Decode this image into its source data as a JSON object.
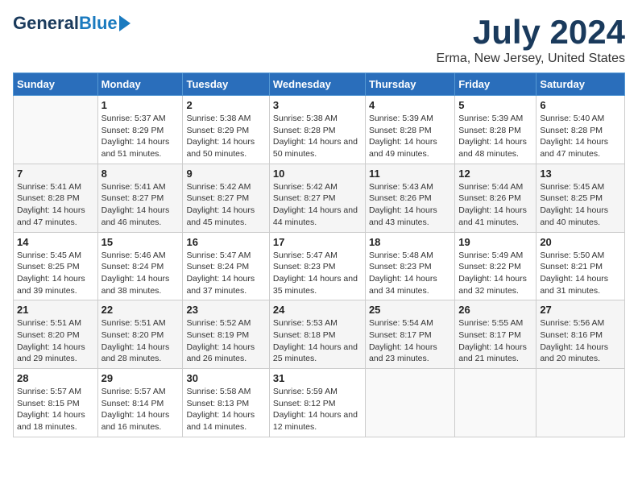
{
  "logo": {
    "general": "General",
    "blue": "Blue"
  },
  "title": "July 2024",
  "subtitle": "Erma, New Jersey, United States",
  "headers": [
    "Sunday",
    "Monday",
    "Tuesday",
    "Wednesday",
    "Thursday",
    "Friday",
    "Saturday"
  ],
  "rows": [
    [
      {
        "day": "",
        "sunrise": "",
        "sunset": "",
        "daylight": ""
      },
      {
        "day": "1",
        "sunrise": "Sunrise: 5:37 AM",
        "sunset": "Sunset: 8:29 PM",
        "daylight": "Daylight: 14 hours and 51 minutes."
      },
      {
        "day": "2",
        "sunrise": "Sunrise: 5:38 AM",
        "sunset": "Sunset: 8:29 PM",
        "daylight": "Daylight: 14 hours and 50 minutes."
      },
      {
        "day": "3",
        "sunrise": "Sunrise: 5:38 AM",
        "sunset": "Sunset: 8:28 PM",
        "daylight": "Daylight: 14 hours and 50 minutes."
      },
      {
        "day": "4",
        "sunrise": "Sunrise: 5:39 AM",
        "sunset": "Sunset: 8:28 PM",
        "daylight": "Daylight: 14 hours and 49 minutes."
      },
      {
        "day": "5",
        "sunrise": "Sunrise: 5:39 AM",
        "sunset": "Sunset: 8:28 PM",
        "daylight": "Daylight: 14 hours and 48 minutes."
      },
      {
        "day": "6",
        "sunrise": "Sunrise: 5:40 AM",
        "sunset": "Sunset: 8:28 PM",
        "daylight": "Daylight: 14 hours and 47 minutes."
      }
    ],
    [
      {
        "day": "7",
        "sunrise": "Sunrise: 5:41 AM",
        "sunset": "Sunset: 8:28 PM",
        "daylight": "Daylight: 14 hours and 47 minutes."
      },
      {
        "day": "8",
        "sunrise": "Sunrise: 5:41 AM",
        "sunset": "Sunset: 8:27 PM",
        "daylight": "Daylight: 14 hours and 46 minutes."
      },
      {
        "day": "9",
        "sunrise": "Sunrise: 5:42 AM",
        "sunset": "Sunset: 8:27 PM",
        "daylight": "Daylight: 14 hours and 45 minutes."
      },
      {
        "day": "10",
        "sunrise": "Sunrise: 5:42 AM",
        "sunset": "Sunset: 8:27 PM",
        "daylight": "Daylight: 14 hours and 44 minutes."
      },
      {
        "day": "11",
        "sunrise": "Sunrise: 5:43 AM",
        "sunset": "Sunset: 8:26 PM",
        "daylight": "Daylight: 14 hours and 43 minutes."
      },
      {
        "day": "12",
        "sunrise": "Sunrise: 5:44 AM",
        "sunset": "Sunset: 8:26 PM",
        "daylight": "Daylight: 14 hours and 41 minutes."
      },
      {
        "day": "13",
        "sunrise": "Sunrise: 5:45 AM",
        "sunset": "Sunset: 8:25 PM",
        "daylight": "Daylight: 14 hours and 40 minutes."
      }
    ],
    [
      {
        "day": "14",
        "sunrise": "Sunrise: 5:45 AM",
        "sunset": "Sunset: 8:25 PM",
        "daylight": "Daylight: 14 hours and 39 minutes."
      },
      {
        "day": "15",
        "sunrise": "Sunrise: 5:46 AM",
        "sunset": "Sunset: 8:24 PM",
        "daylight": "Daylight: 14 hours and 38 minutes."
      },
      {
        "day": "16",
        "sunrise": "Sunrise: 5:47 AM",
        "sunset": "Sunset: 8:24 PM",
        "daylight": "Daylight: 14 hours and 37 minutes."
      },
      {
        "day": "17",
        "sunrise": "Sunrise: 5:47 AM",
        "sunset": "Sunset: 8:23 PM",
        "daylight": "Daylight: 14 hours and 35 minutes."
      },
      {
        "day": "18",
        "sunrise": "Sunrise: 5:48 AM",
        "sunset": "Sunset: 8:23 PM",
        "daylight": "Daylight: 14 hours and 34 minutes."
      },
      {
        "day": "19",
        "sunrise": "Sunrise: 5:49 AM",
        "sunset": "Sunset: 8:22 PM",
        "daylight": "Daylight: 14 hours and 32 minutes."
      },
      {
        "day": "20",
        "sunrise": "Sunrise: 5:50 AM",
        "sunset": "Sunset: 8:21 PM",
        "daylight": "Daylight: 14 hours and 31 minutes."
      }
    ],
    [
      {
        "day": "21",
        "sunrise": "Sunrise: 5:51 AM",
        "sunset": "Sunset: 8:20 PM",
        "daylight": "Daylight: 14 hours and 29 minutes."
      },
      {
        "day": "22",
        "sunrise": "Sunrise: 5:51 AM",
        "sunset": "Sunset: 8:20 PM",
        "daylight": "Daylight: 14 hours and 28 minutes."
      },
      {
        "day": "23",
        "sunrise": "Sunrise: 5:52 AM",
        "sunset": "Sunset: 8:19 PM",
        "daylight": "Daylight: 14 hours and 26 minutes."
      },
      {
        "day": "24",
        "sunrise": "Sunrise: 5:53 AM",
        "sunset": "Sunset: 8:18 PM",
        "daylight": "Daylight: 14 hours and 25 minutes."
      },
      {
        "day": "25",
        "sunrise": "Sunrise: 5:54 AM",
        "sunset": "Sunset: 8:17 PM",
        "daylight": "Daylight: 14 hours and 23 minutes."
      },
      {
        "day": "26",
        "sunrise": "Sunrise: 5:55 AM",
        "sunset": "Sunset: 8:17 PM",
        "daylight": "Daylight: 14 hours and 21 minutes."
      },
      {
        "day": "27",
        "sunrise": "Sunrise: 5:56 AM",
        "sunset": "Sunset: 8:16 PM",
        "daylight": "Daylight: 14 hours and 20 minutes."
      }
    ],
    [
      {
        "day": "28",
        "sunrise": "Sunrise: 5:57 AM",
        "sunset": "Sunset: 8:15 PM",
        "daylight": "Daylight: 14 hours and 18 minutes."
      },
      {
        "day": "29",
        "sunrise": "Sunrise: 5:57 AM",
        "sunset": "Sunset: 8:14 PM",
        "daylight": "Daylight: 14 hours and 16 minutes."
      },
      {
        "day": "30",
        "sunrise": "Sunrise: 5:58 AM",
        "sunset": "Sunset: 8:13 PM",
        "daylight": "Daylight: 14 hours and 14 minutes."
      },
      {
        "day": "31",
        "sunrise": "Sunrise: 5:59 AM",
        "sunset": "Sunset: 8:12 PM",
        "daylight": "Daylight: 14 hours and 12 minutes."
      },
      {
        "day": "",
        "sunrise": "",
        "sunset": "",
        "daylight": ""
      },
      {
        "day": "",
        "sunrise": "",
        "sunset": "",
        "daylight": ""
      },
      {
        "day": "",
        "sunrise": "",
        "sunset": "",
        "daylight": ""
      }
    ]
  ]
}
